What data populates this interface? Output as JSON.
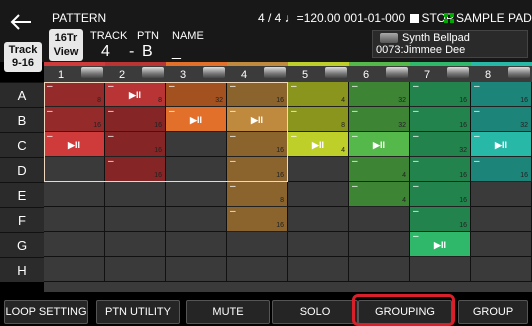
{
  "header": {
    "title": "PATTERN",
    "time_info": "4 / 4 ♩=120.00  001-01-000",
    "stop_label": "STOP",
    "sample_pad_label": "SAMPLE PAD",
    "view_button": "16Tr View",
    "track_label": "TRACK",
    "ptn_label": "PTN",
    "name_label": "NAME",
    "track_value": "4",
    "dash": "-",
    "ptn_value": "B",
    "name_value": "_",
    "tone_name": "Synth Bellpad",
    "tone_number": "0073:Jimmee Dee"
  },
  "left": {
    "track_button": "Track 9-16",
    "rows": [
      "A",
      "B",
      "C",
      "D",
      "E",
      "F",
      "G",
      "H"
    ]
  },
  "columns": [
    {
      "num": "1",
      "color": "#cf3b3b",
      "cells": [
        {
          "state": "pattern",
          "len": "8"
        },
        {
          "state": "pattern",
          "len": "16"
        },
        {
          "state": "play",
          "len": ""
        },
        {
          "state": "empty"
        },
        {
          "state": "empty"
        },
        {
          "state": "empty"
        },
        {
          "state": "empty"
        },
        {
          "state": "empty"
        }
      ]
    },
    {
      "num": "2",
      "color": "#b93434",
      "cells": [
        {
          "state": "play",
          "len": "8"
        },
        {
          "state": "pattern",
          "len": "16"
        },
        {
          "state": "pattern",
          "len": "16"
        },
        {
          "state": "pattern",
          "len": "16"
        },
        {
          "state": "empty"
        },
        {
          "state": "empty"
        },
        {
          "state": "empty"
        },
        {
          "state": "empty"
        }
      ]
    },
    {
      "num": "3",
      "color": "#e3702a",
      "cells": [
        {
          "state": "pattern",
          "len": "32"
        },
        {
          "state": "play",
          "len": ""
        },
        {
          "state": "empty"
        },
        {
          "state": "empty"
        },
        {
          "state": "empty"
        },
        {
          "state": "empty"
        },
        {
          "state": "empty"
        },
        {
          "state": "empty"
        }
      ]
    },
    {
      "num": "4",
      "color": "#c08a3e",
      "cells": [
        {
          "state": "pattern",
          "len": "16"
        },
        {
          "state": "play",
          "len": ""
        },
        {
          "state": "pattern",
          "len": "16"
        },
        {
          "state": "pattern",
          "len": "16"
        },
        {
          "state": "pattern",
          "len": "8"
        },
        {
          "state": "pattern",
          "len": "16"
        },
        {
          "state": "empty"
        },
        {
          "state": "empty"
        }
      ]
    },
    {
      "num": "5",
      "color": "#bfcf2a",
      "cells": [
        {
          "state": "pattern",
          "len": "4"
        },
        {
          "state": "pattern",
          "len": "8"
        },
        {
          "state": "play",
          "len": "4"
        },
        {
          "state": "empty"
        },
        {
          "state": "empty"
        },
        {
          "state": "empty"
        },
        {
          "state": "empty"
        },
        {
          "state": "empty"
        }
      ]
    },
    {
      "num": "6",
      "color": "#55b84a",
      "cells": [
        {
          "state": "pattern",
          "len": "32"
        },
        {
          "state": "pattern",
          "len": "32"
        },
        {
          "state": "play",
          "len": ""
        },
        {
          "state": "pattern",
          "len": "4"
        },
        {
          "state": "pattern",
          "len": "4"
        },
        {
          "state": "empty"
        },
        {
          "state": "empty"
        },
        {
          "state": "empty"
        }
      ]
    },
    {
      "num": "7",
      "color": "#2fb86a",
      "cells": [
        {
          "state": "pattern",
          "len": "16"
        },
        {
          "state": "pattern",
          "len": "16"
        },
        {
          "state": "pattern",
          "len": "32"
        },
        {
          "state": "pattern",
          "len": "16"
        },
        {
          "state": "pattern",
          "len": "16"
        },
        {
          "state": "pattern",
          "len": "16"
        },
        {
          "state": "play",
          "len": ""
        },
        {
          "state": "empty"
        }
      ]
    },
    {
      "num": "8",
      "color": "#27b8a8",
      "cells": [
        {
          "state": "pattern",
          "len": "16"
        },
        {
          "state": "pattern",
          "len": "32"
        },
        {
          "state": "play",
          "len": ""
        },
        {
          "state": "pattern",
          "len": "16"
        },
        {
          "state": "empty"
        },
        {
          "state": "empty"
        },
        {
          "state": "empty"
        },
        {
          "state": "empty"
        }
      ]
    }
  ],
  "play_glyph": "▶II",
  "bottom_buttons": [
    "LOOP SETTING",
    "PTN UTILITY",
    "MUTE",
    "SOLO",
    "GROUPING",
    "GROUP"
  ],
  "colors": {
    "highlight": "#d8202a",
    "selection": "#f0d8c0"
  }
}
